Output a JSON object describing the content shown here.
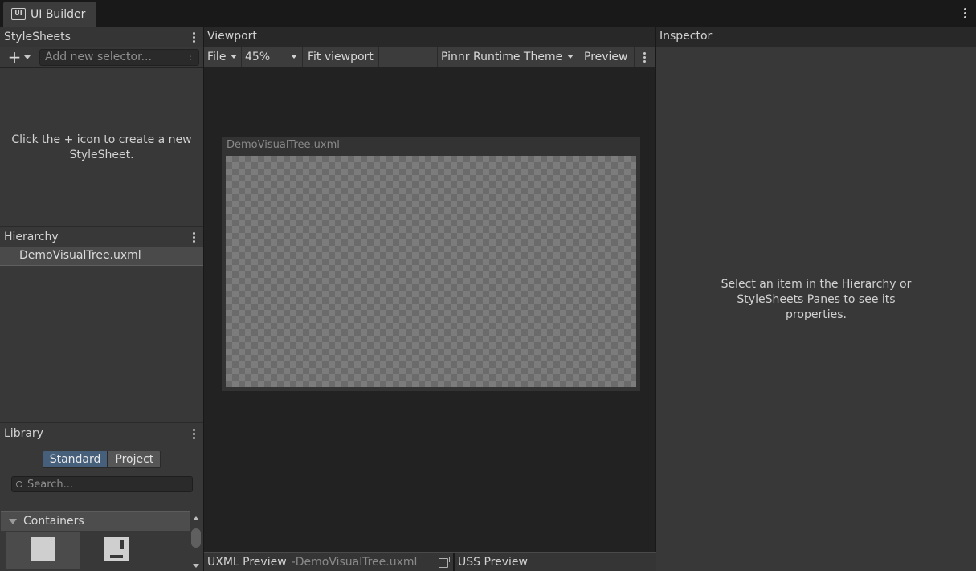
{
  "window": {
    "tab_label": "UI Builder",
    "tab_icon": "ui-builder-icon"
  },
  "stylesheets": {
    "title": "StyleSheets",
    "add_selector_placeholder": "Add new selector...",
    "empty_message": "Click the + icon to create a new StyleSheet."
  },
  "hierarchy": {
    "title": "Hierarchy",
    "items": [
      "DemoVisualTree.uxml"
    ]
  },
  "library": {
    "title": "Library",
    "tabs": [
      "Standard",
      "Project"
    ],
    "active_tab": "Standard",
    "search_placeholder": "Search...",
    "section": "Containers",
    "items": [
      "visual-element-icon",
      "scroll-view-icon"
    ]
  },
  "viewport": {
    "title": "Viewport",
    "toolbar": {
      "file": "File",
      "zoom": "45%",
      "fit": "Fit viewport",
      "theme": "Pinnr Runtime Theme",
      "preview": "Preview"
    },
    "canvas_label": "DemoVisualTree.uxml",
    "uxml_preview_label": "UXML Preview",
    "uxml_preview_file": "-DemoVisualTree.uxml",
    "uss_preview_label": "USS Preview"
  },
  "inspector": {
    "title": "Inspector",
    "empty_message": "Select an item in the Hierarchy or StyleSheets Panes to see its properties."
  },
  "colors": {
    "accent_selected_tab": "#46607c",
    "panel_bg": "#383838",
    "viewport_bg": "#222222"
  }
}
